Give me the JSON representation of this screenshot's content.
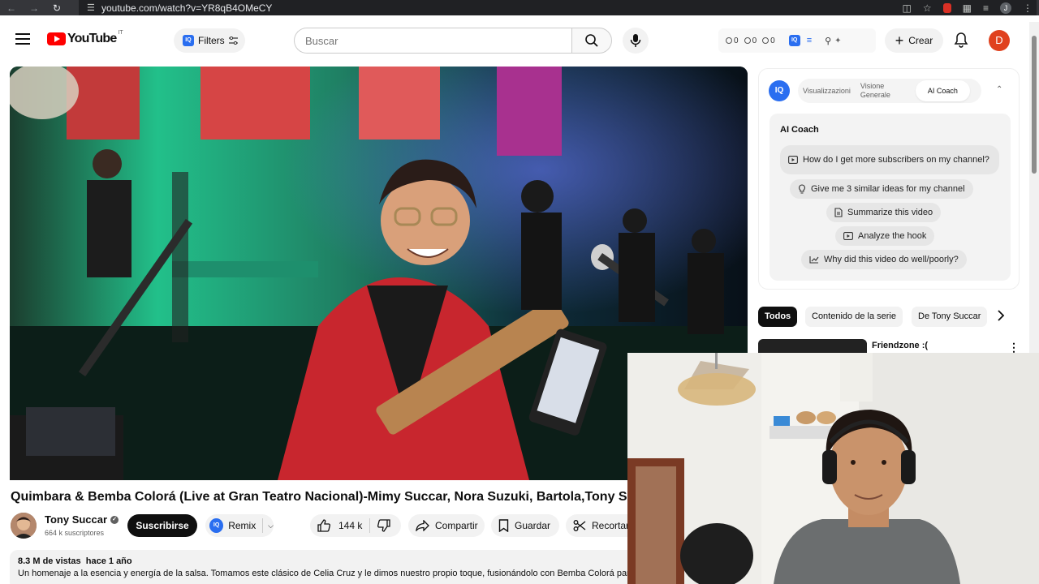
{
  "browser": {
    "url": "youtube.com/watch?v=YR8qB4OMeCY",
    "profile_initial": "J"
  },
  "header": {
    "logo_text": "YouTube",
    "country_code": "IT",
    "filters_label": "Filters",
    "search_placeholder": "Buscar",
    "stats": [
      "0",
      "0",
      "0"
    ],
    "create_label": "Crear",
    "avatar_initial": "D",
    "iq_badge": "IQ"
  },
  "video": {
    "title": "Quimbara & Bemba Colorá (Live at Gran Teatro Nacional)-Mimy Succar, Nora Suzuki, Bartola,Tony Succar",
    "channel_name": "Tony Succar",
    "subscribers": "664 k suscriptores",
    "subscribe_label": "Suscribirse",
    "remix_label": "Remix",
    "likes": "144 k",
    "share_label": "Compartir",
    "save_label": "Guardar",
    "clip_label": "Recortar",
    "views_meta": "8.3 M de vistas  hace 1 año",
    "description": "Un homenaje a la esencia y energía de la salsa. Tomamos este clásico de Celia Cruz y le dimos nuestro propio toque, fusionándolo con Bemba Colorá para"
  },
  "coach": {
    "tabs": [
      "Visualizzazioni",
      "Visione Generale",
      "AI Coach"
    ],
    "active_tab": "AI Coach",
    "title": "AI Coach",
    "suggestions": [
      "How do I get more subscribers on my channel?",
      "Give me 3 similar ideas for my channel",
      "Summarize this video",
      "Analyze the hook",
      "Why did this video do well/poorly?"
    ]
  },
  "chips": [
    "Todos",
    "Contenido de la serie",
    "De Tony Succar"
  ],
  "recommendation": {
    "title": "Friendzone :("
  },
  "colors": {
    "youtube_red": "#ff0000",
    "iq_blue": "#2a6ef0",
    "avatar_orange": "#e0411e"
  }
}
